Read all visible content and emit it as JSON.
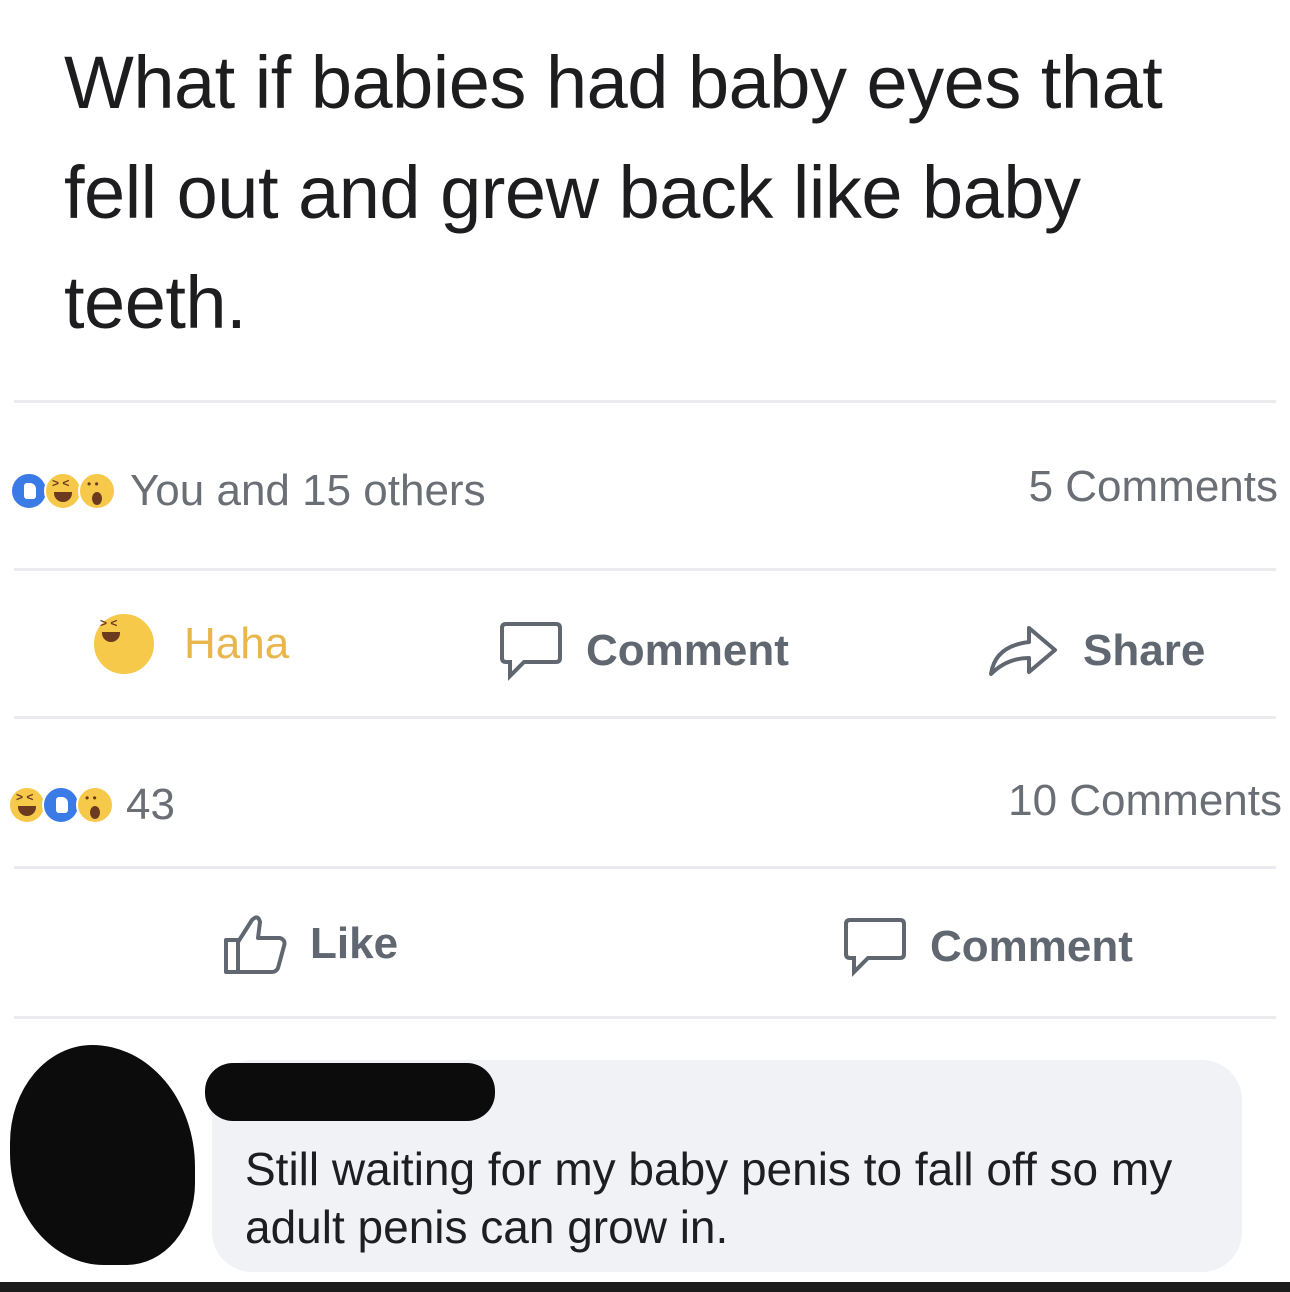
{
  "post": {
    "text": "What if babies had baby eyes that fell out and grew back like baby teeth."
  },
  "post_stats": {
    "reaction_icons": [
      "like-reaction-icon",
      "haha-reaction-icon",
      "wow-reaction-icon"
    ],
    "reactions_text": "You and 15 others",
    "comments_text": "5 Comments"
  },
  "post_actions": {
    "haha_label": "Haha",
    "comment_label": "Comment",
    "share_label": "Share"
  },
  "second_stats": {
    "reaction_icons": [
      "haha-reaction-icon",
      "like-reaction-icon",
      "wow-reaction-icon"
    ],
    "reactions_count": "43",
    "comments_text": "10 Comments"
  },
  "second_actions": {
    "like_label": "Like",
    "comment_label": "Comment"
  },
  "comment": {
    "text": "Still waiting for my baby penis to fall off so my adult penis can grow in."
  },
  "colors": {
    "like_blue": "#3b7be6",
    "haha_yellow": "#f7c94a",
    "text_gray": "#606770"
  }
}
